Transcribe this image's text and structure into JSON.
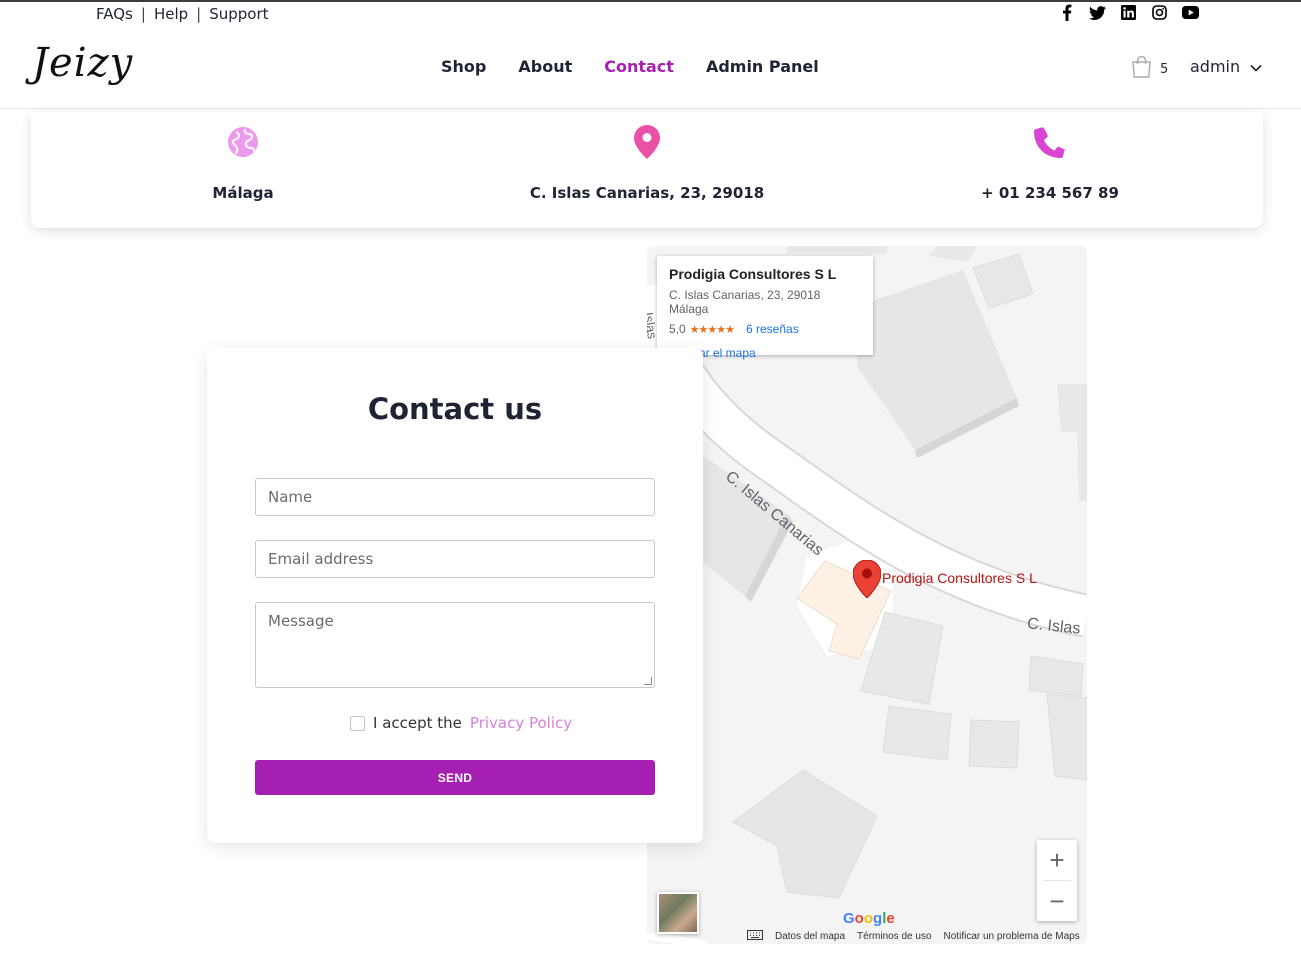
{
  "utility": {
    "links": [
      "FAQs",
      "Help",
      "Support"
    ],
    "separator": "|"
  },
  "social_icons": [
    "facebook-icon",
    "twitter-icon",
    "linkedin-icon",
    "instagram-icon",
    "youtube-icon"
  ],
  "header": {
    "logo": "Jeizy",
    "nav": [
      "Shop",
      "About",
      "Contact",
      "Admin Panel"
    ],
    "active_nav": "Contact",
    "cart_count": "5",
    "user": "admin"
  },
  "info": {
    "city": "Málaga",
    "address": "C. Islas Canarias, 23, 29018",
    "phone": "+ 01 234 567 89"
  },
  "map": {
    "place_name": "Prodigia Consultores S L",
    "place_address": "C. Islas Canarias, 23, 29018 Málaga",
    "rating": "5,0",
    "stars": "★★★★★",
    "reviews": "6 reseñas",
    "enlarge": "Ampliar el mapa",
    "street_label_1": "C. Islas Canarias",
    "street_label_2": "C. Islas",
    "street_label_3": "Islas",
    "pin_label": "Prodigia Consultores S L",
    "zoom_in": "+",
    "zoom_out": "−",
    "brand": "Google",
    "footer": [
      "Datos del mapa",
      "Términos de uso",
      "Notificar un problema de Maps"
    ]
  },
  "form": {
    "title": "Contact us",
    "name_placeholder": "Name",
    "email_placeholder": "Email address",
    "message_placeholder": "Message",
    "policy_text": "I accept the",
    "policy_link": "Privacy Policy",
    "send": "SEND"
  },
  "colors": {
    "accent": "#a41fb2",
    "link_pink": "#d780dc",
    "text": "#1f2433"
  }
}
